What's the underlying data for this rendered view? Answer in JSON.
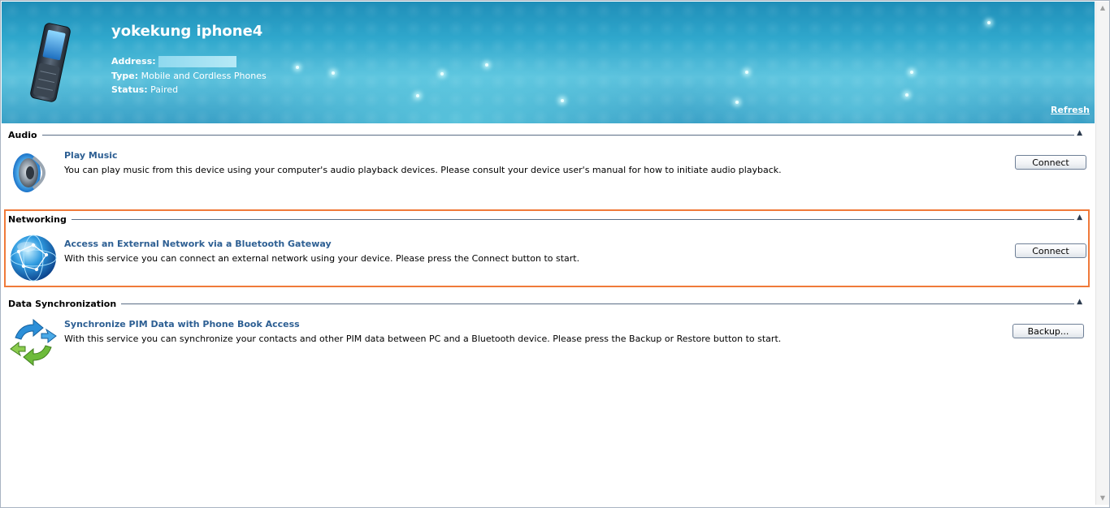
{
  "device": {
    "name": "yokekung iphone4",
    "address_label": "Address:",
    "address_value": "",
    "type_label": "Type:",
    "type_value": "Mobile and Cordless Phones",
    "status_label": "Status:",
    "status_value": "Paired",
    "refresh_label": "Refresh"
  },
  "sections": [
    {
      "heading": "Audio",
      "service_title": "Play Music",
      "service_desc": "You can play music from this device using your computer's audio playback devices. Please consult your device user's manual for how to initiate audio playback.",
      "button_label": "Connect",
      "icon": "speaker-icon"
    },
    {
      "heading": "Networking",
      "service_title": "Access an External Network via a Bluetooth Gateway",
      "service_desc": "With this service you can connect an external network using your device. Please press the Connect button to start.",
      "button_label": "Connect",
      "icon": "globe-network-icon"
    },
    {
      "heading": "Data Synchronization",
      "service_title": "Synchronize PIM Data with Phone Book Access",
      "service_desc": "With this service you can synchronize your contacts and other PIM data between PC and a Bluetooth device. Please press the Backup or Restore button to start.",
      "button_label": "Backup...",
      "icon": "sync-arrows-icon"
    }
  ],
  "colors": {
    "banner": "#2fa7cc",
    "link": "#2d5f93",
    "highlight": "#f07a3a"
  }
}
